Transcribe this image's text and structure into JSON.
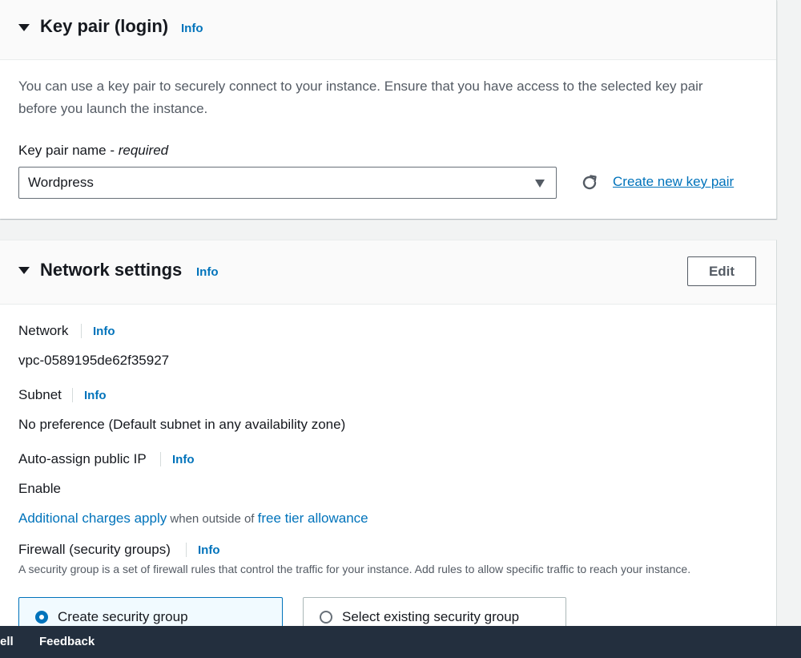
{
  "keypair": {
    "title": "Key pair (login)",
    "info": "Info",
    "description": "You can use a key pair to securely connect to your instance. Ensure that you have access to the selected key pair before you launch the instance.",
    "field_label": "Key pair name - ",
    "field_required": "required",
    "selected_value": "Wordpress",
    "create_link": "Create new key pair"
  },
  "network": {
    "title": "Network settings",
    "info": "Info",
    "edit_label": "Edit",
    "network_label": "Network",
    "network_value": "vpc-0589195de62f35927",
    "subnet_label": "Subnet",
    "subnet_value": "No preference (Default subnet in any availability zone)",
    "autoip_label": "Auto-assign public IP",
    "autoip_value": "Enable",
    "charges_link": "Additional charges apply",
    "charges_text": " when outside of ",
    "free_tier_link": "free tier allowance",
    "firewall_label": "Firewall (security groups)",
    "firewall_description": "A security group is a set of firewall rules that control the traffic for your instance. Add rules to allow specific traffic to reach your instance.",
    "options": [
      {
        "label": "Create security group",
        "selected": true
      },
      {
        "label": "Select existing security group",
        "selected": false
      }
    ]
  },
  "footer": {
    "left_partial": "ell",
    "feedback": "Feedback"
  },
  "colors": {
    "link": "#0073bb",
    "footer_bg": "#232f3e"
  }
}
